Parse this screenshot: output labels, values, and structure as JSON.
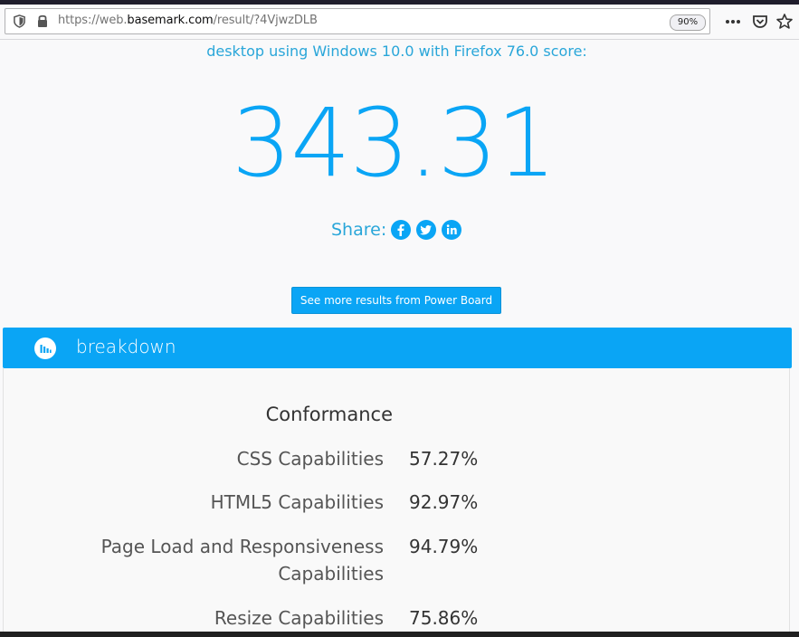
{
  "browser": {
    "url_scheme": "https://web.",
    "url_host": "basemark.com",
    "url_path": "/result/?4VjwzDLB",
    "zoom": "90%",
    "icons": [
      "shield-icon",
      "lock-icon",
      "more-actions-icon",
      "pocket-icon",
      "bookmark-star-icon"
    ]
  },
  "result": {
    "subtitle": "desktop using Windows 10.0 with Firefox 76.0 score:",
    "score": "343.31",
    "share_label": "Share:",
    "power_board_button": "See more results from Power Board"
  },
  "breakdown": {
    "title": "breakdown",
    "section_title": "Conformance",
    "rows": [
      {
        "label": "CSS Capabilities",
        "value": "57.27%"
      },
      {
        "label": "HTML5 Capabilities",
        "value": "92.97%"
      },
      {
        "label": "Page Load and Responsiveness Capabilities",
        "value": "94.79%"
      },
      {
        "label": "Resize Capabilities",
        "value": "75.86%"
      }
    ]
  },
  "colors": {
    "accent": "#0aa5f5",
    "subtitle_text": "#29a6d9"
  }
}
